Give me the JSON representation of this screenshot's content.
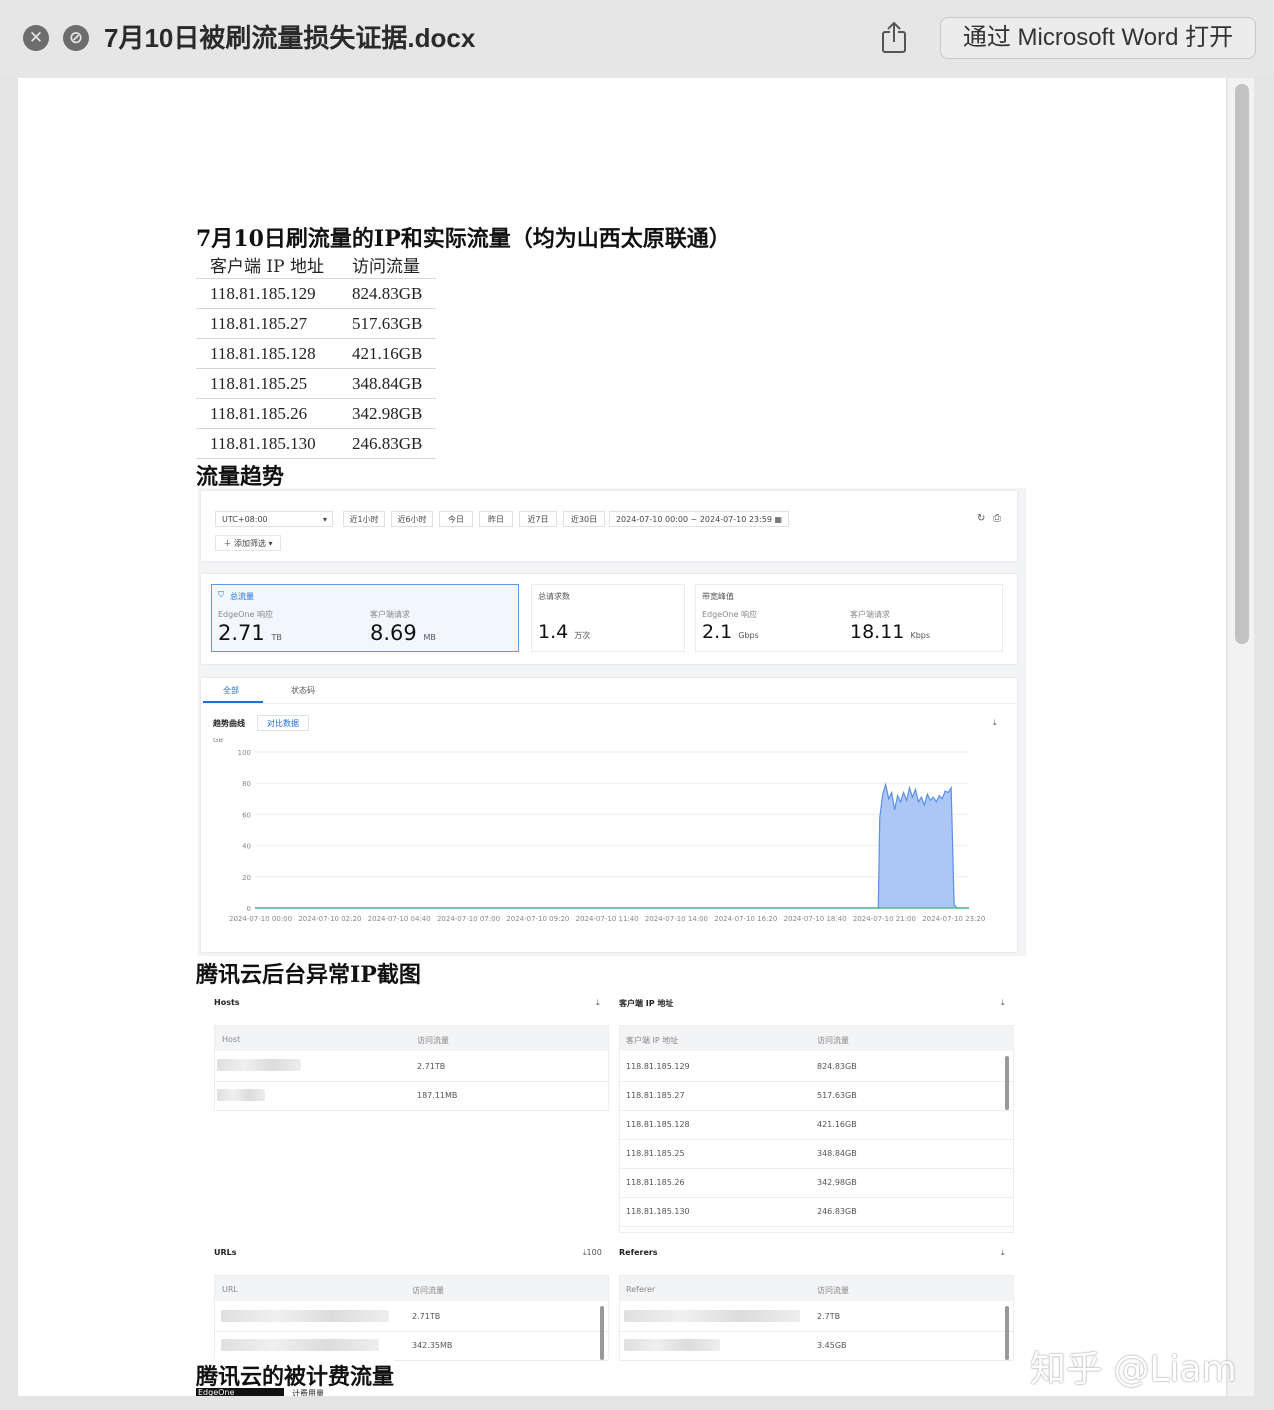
{
  "window": {
    "title": "7月10日被刷流量损失证据.docx",
    "open_button": "通过 Microsoft Word 打开",
    "close_icon": "close-icon",
    "hide_icon": "slash-icon",
    "share_icon": "share-icon"
  },
  "doc": {
    "heading1": "7月10日刷流量的IP和实际流量（均为山西太原联通）",
    "table": {
      "headers": [
        "客户端 IP 地址",
        "访问流量"
      ],
      "rows": [
        [
          "118.81.185.129",
          "824.83GB"
        ],
        [
          "118.81.185.27",
          "517.63GB"
        ],
        [
          "118.81.185.128",
          "421.16GB"
        ],
        [
          "118.81.185.25",
          "348.84GB"
        ],
        [
          "118.81.185.26",
          "342.98GB"
        ],
        [
          "118.81.185.130",
          "246.83GB"
        ]
      ]
    },
    "heading2": "流量趋势",
    "heading3": "腾讯云后台异常IP截图",
    "heading4": "腾讯云的被计费流量",
    "bottom_label": "EdgeOne",
    "bottom_sublabel": "计费用量"
  },
  "trend_shot": {
    "timezone": "UTC+08:00",
    "ranges": [
      "近1小时",
      "近6小时",
      "今日",
      "昨日",
      "近7日",
      "近30日"
    ],
    "date_from": "2024-07-10 00:00",
    "date_sep": "~",
    "date_to": "2024-07-10 23:59",
    "add_filter": "添加筛选",
    "stats": {
      "total_traffic_label": "总流量",
      "edgeone_resp": "EdgeOne 响应",
      "client_req": "客户端请求",
      "traffic_value": "2.71",
      "traffic_unit": "TB",
      "client_value": "8.69",
      "client_unit": "MB",
      "requests_label": "总请求数",
      "requests_value": "1.4",
      "requests_unit": "万次",
      "bandwidth_label": "带宽峰值",
      "bw_edge_label": "EdgeOne 响应",
      "bw_edge_value": "2.1",
      "bw_edge_unit": "Gbps",
      "bw_client_label": "客户端请求",
      "bw_client_value": "18.11",
      "bw_client_unit": "Kbps"
    },
    "tabs": [
      "全部",
      "状态码"
    ],
    "curve_label": "趋势曲线",
    "compare_btn": "对比数据",
    "colors": {
      "accent": "#1f6fdb",
      "area": "#a8c4f5",
      "line": "#5b8fe6",
      "baseline": "#3cb371"
    }
  },
  "chart_data": {
    "type": "area",
    "ylabel": "GB",
    "ylim": [
      0,
      100
    ],
    "yticks": [
      0,
      20,
      40,
      60,
      80,
      100
    ],
    "x_ticks": [
      "2024-07-10 00:00",
      "2024-07-10 02:20",
      "2024-07-10 04:40",
      "2024-07-10 07:00",
      "2024-07-10 09:20",
      "2024-07-10 11:40",
      "2024-07-10 14:00",
      "2024-07-10 16:20",
      "2024-07-10 18:40",
      "2024-07-10 21:00",
      "2024-07-10 23:20"
    ],
    "x_hours": [
      0,
      10.1,
      10.2,
      10.4,
      10.5,
      10.6,
      10.8,
      10.9,
      11.0,
      11.2,
      11.3,
      11.4,
      11.6,
      11.7,
      11.8,
      12.0,
      12.1,
      12.2,
      12.3,
      12.5,
      12.6,
      12.7,
      12.8,
      12.9,
      13.0,
      13.1,
      13.2,
      13.4,
      13.5,
      13.6,
      13.8,
      13.9,
      14.0,
      14.2,
      14.3,
      14.4,
      14.6,
      14.7,
      14.8,
      14.9,
      15.0,
      15.1,
      15.2,
      15.3,
      15.4,
      15.5,
      15.7,
      15.8,
      15.9,
      16.0,
      16.2,
      16.3,
      16.4,
      16.5,
      16.7,
      16.8,
      16.9,
      17.0,
      17.1,
      17.3,
      17.4,
      17.5,
      17.6,
      17.8,
      17.9,
      18.0,
      18.1,
      18.3,
      18.4,
      18.5,
      18.6,
      18.8,
      18.9,
      19.0,
      19.1,
      19.2,
      19.3,
      19.4,
      19.5,
      19.6,
      19.7,
      19.8,
      19.9,
      20.0,
      20.1,
      20.2,
      20.3,
      20.4,
      20.5,
      20.6,
      20.7,
      20.8,
      20.9,
      20.95,
      21.0,
      21.1,
      21.2,
      21.3,
      21.4,
      21.5,
      21.6,
      21.7,
      21.8,
      21.9,
      22.0,
      22.1,
      22.2,
      22.3,
      22.4,
      22.5,
      22.6,
      22.7,
      22.8,
      22.9,
      23.0,
      23.1,
      23.2,
      23.3,
      23.4,
      23.5,
      23.6,
      23.7,
      23.8,
      23.9,
      24.0
    ],
    "series": [
      {
        "values": [
          0,
          0,
          0,
          0,
          0,
          0,
          0,
          0,
          0,
          0,
          0,
          0,
          0,
          0,
          0,
          0,
          0,
          0,
          0,
          0,
          0,
          0,
          0,
          0,
          0,
          0,
          0,
          0,
          0,
          0,
          0,
          0,
          0,
          0,
          0,
          0,
          0,
          0,
          0,
          0,
          0,
          0,
          0,
          0,
          0,
          0,
          0,
          0,
          0,
          0,
          0,
          0,
          0,
          0,
          0,
          0,
          0,
          0,
          0,
          0,
          0,
          0,
          0,
          0,
          0,
          0,
          0,
          0,
          0,
          0,
          0,
          0,
          0,
          0,
          0,
          0,
          0,
          0,
          0,
          0,
          0,
          0,
          0,
          0,
          0,
          0,
          0,
          0,
          0,
          0,
          0,
          0,
          0,
          0,
          58,
          73,
          79,
          70,
          74,
          63,
          72,
          68,
          74,
          69,
          77,
          71,
          76,
          68,
          71,
          66,
          73,
          69,
          71,
          68,
          72,
          70,
          75,
          74,
          77,
          2,
          0,
          0,
          0,
          0,
          0
        ]
      }
    ]
  },
  "ip_shot": {
    "hosts_title": "Hosts",
    "hosts_headers": [
      "Host",
      "访问流量"
    ],
    "hosts_values": [
      "2.71TB",
      "187.11MB"
    ],
    "client_title": "客户端 IP 地址",
    "client_headers": [
      "客户端 IP 地址",
      "访问流量"
    ],
    "client_rows": [
      [
        "118.81.185.129",
        "824.83GB"
      ],
      [
        "118.81.185.27",
        "517.63GB"
      ],
      [
        "118.81.185.128",
        "421.16GB"
      ],
      [
        "118.81.185.25",
        "348.84GB"
      ],
      [
        "118.81.185.26",
        "342.98GB"
      ],
      [
        "118.81.185.130",
        "246.83GB"
      ]
    ],
    "urls_title": "URLs",
    "urls_count": "100",
    "urls_headers": [
      "URL",
      "访问流量"
    ],
    "urls_values": [
      "2.71TB",
      "342.35MB"
    ],
    "referers_title": "Referers",
    "referers_headers": [
      "Referer",
      "访问流量"
    ],
    "referers_values": [
      "2.7TB",
      "3.45GB"
    ]
  },
  "watermark": "知乎 @Liam"
}
